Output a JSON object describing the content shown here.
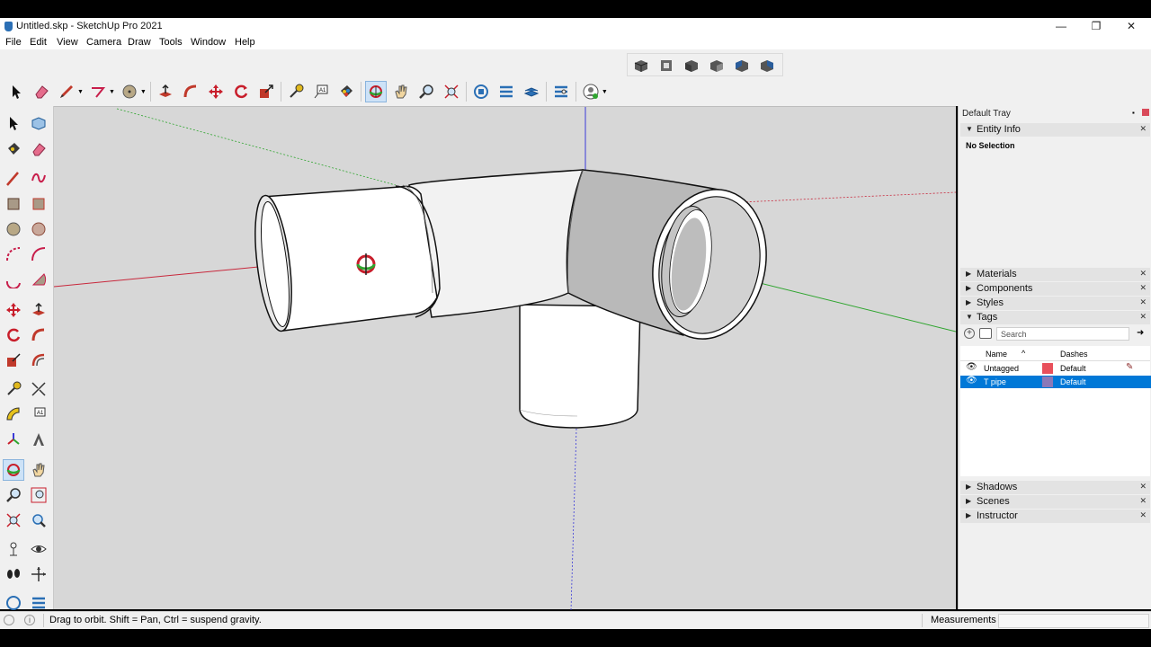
{
  "window": {
    "title": "Untitled.skp - SketchUp Pro 2021",
    "minimize": "—",
    "restore": "❐",
    "close": "✕"
  },
  "menu": [
    "File",
    "Edit",
    "View",
    "Camera",
    "Draw",
    "Tools",
    "Window",
    "Help"
  ],
  "main_toolbar_icons": [
    "select-icon",
    "eraser-icon",
    "pencil-icon",
    "freehand-icon",
    "circle-icon",
    "push-pull-icon",
    "follow-me-icon",
    "move-icon",
    "rotate-icon",
    "scale-icon",
    "tape-measure-icon",
    "text-icon",
    "paint-bucket-icon",
    "orbit-icon",
    "pan-icon",
    "zoom-icon",
    "zoom-extents-icon",
    "3d-warehouse-icon",
    "extension-warehouse-icon",
    "layout-icon",
    "extension-manager-icon",
    "profile-icon"
  ],
  "view_toolbar_icons": [
    "iso-view-icon",
    "top-view-icon",
    "front-view-icon",
    "right-view-icon",
    "back-view-icon",
    "left-view-icon"
  ],
  "tray": {
    "title": "Default Tray",
    "entity_info": {
      "label": "Entity Info",
      "selection": "No Selection"
    },
    "panels_collapsed_top": [
      "Materials",
      "Components",
      "Styles"
    ],
    "tags": {
      "label": "Tags",
      "search_placeholder": "Search",
      "columns": {
        "name": "Name",
        "dashes": "Dashes"
      },
      "rows": [
        {
          "name": "Untagged",
          "dashes": "Default",
          "color": "#e8505b",
          "selected": false
        },
        {
          "name": "T pipe",
          "dashes": "Default",
          "color": "#8a78b8",
          "selected": true
        }
      ]
    },
    "panels_collapsed_bottom": [
      "Shadows",
      "Scenes",
      "Instructor"
    ]
  },
  "status": {
    "message": "Drag to orbit. Shift = Pan, Ctrl = suspend gravity.",
    "measurements_label": "Measurements",
    "measurements_value": ""
  },
  "colors": {
    "selection": "#0078d7",
    "axis_red": "#c8283c",
    "axis_green": "#2fa52f",
    "axis_blue": "#3a3ad8"
  }
}
